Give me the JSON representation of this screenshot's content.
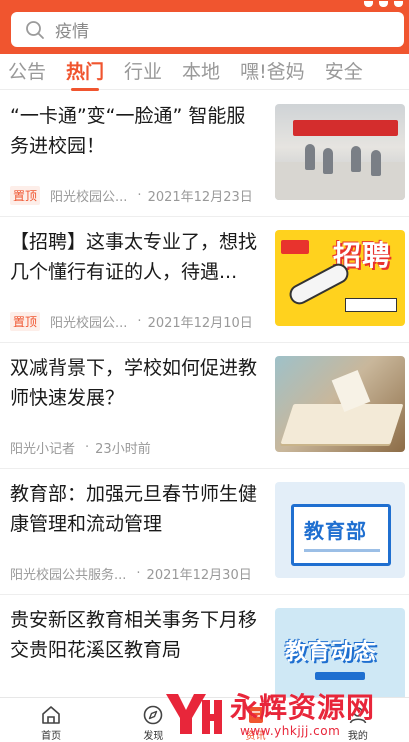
{
  "search": {
    "text": "疫情"
  },
  "tabs": [
    {
      "label": "公告",
      "active": false
    },
    {
      "label": "热门",
      "active": true
    },
    {
      "label": "行业",
      "active": false
    },
    {
      "label": "本地",
      "active": false
    },
    {
      "label": "嘿!爸妈",
      "active": false
    },
    {
      "label": "安全",
      "active": false
    }
  ],
  "news": [
    {
      "title": "“一卡通”变“一脸通” 智能服务进校园！",
      "pinned": "置顶",
      "source": "阳光校园公...",
      "time": "2021年12月23日"
    },
    {
      "title": "【招聘】这事太专业了，想找几个懂行有证的人，待遇...",
      "pinned": "置顶",
      "source": "阳光校园公...",
      "time": "2021年12月10日",
      "thumb_text": "招聘"
    },
    {
      "title": "双减背景下，学校如何促进教师快速发展？",
      "source": "阳光小记者",
      "time": "23小时前"
    },
    {
      "title": "教育部：加强元旦春节师生健康管理和流动管理",
      "source": "阳光校园公共服务...",
      "time": "2021年12月30日",
      "thumb_text": "教育部"
    },
    {
      "title": "贵安新区教育相关事务下月移交贵阳花溪区教育局",
      "thumb_text": "教育动态"
    }
  ],
  "bottom_nav": [
    {
      "label": "首页",
      "icon": "home-icon",
      "active": false
    },
    {
      "label": "发现",
      "icon": "compass-icon",
      "active": false
    },
    {
      "label": "资讯",
      "icon": "news-icon",
      "active": true
    },
    {
      "label": "我的",
      "icon": "profile-icon",
      "active": false
    }
  ],
  "watermark": {
    "text": "永辉资源网",
    "url": "www.yhkjjj.com"
  },
  "colors": {
    "accent": "#f0552f",
    "watermark": "#e8263a"
  }
}
